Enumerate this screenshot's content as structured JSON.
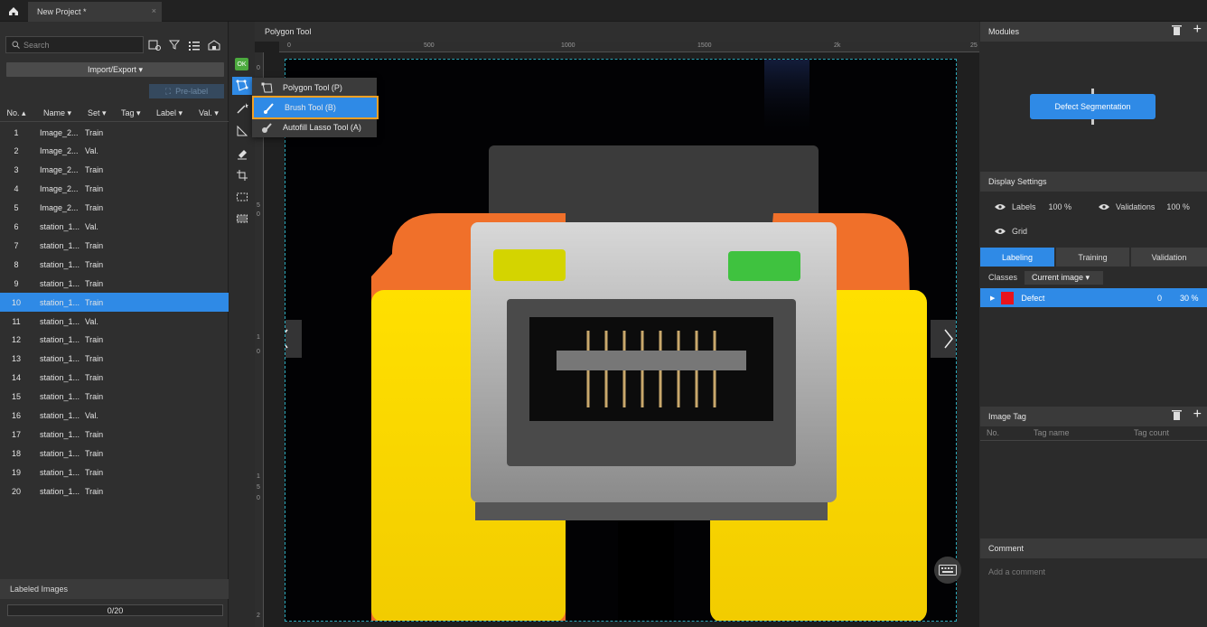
{
  "tab": {
    "title": "New Project *",
    "close": "×"
  },
  "search": {
    "placeholder": "Search"
  },
  "left": {
    "import_label": "Import/Export ▾",
    "prelabel": "Pre-label",
    "columns": [
      "No.",
      "Name",
      "Set",
      "Tag",
      "Label",
      "Val."
    ],
    "rows": [
      {
        "no": "1",
        "name": "Image_2...",
        "set": "Train"
      },
      {
        "no": "2",
        "name": "Image_2...",
        "set": "Val."
      },
      {
        "no": "3",
        "name": "Image_2...",
        "set": "Train"
      },
      {
        "no": "4",
        "name": "Image_2...",
        "set": "Train"
      },
      {
        "no": "5",
        "name": "Image_2...",
        "set": "Train"
      },
      {
        "no": "6",
        "name": "station_1...",
        "set": "Val."
      },
      {
        "no": "7",
        "name": "station_1...",
        "set": "Train"
      },
      {
        "no": "8",
        "name": "station_1...",
        "set": "Train"
      },
      {
        "no": "9",
        "name": "station_1...",
        "set": "Train"
      },
      {
        "no": "10",
        "name": "station_1...",
        "set": "Train"
      },
      {
        "no": "11",
        "name": "station_1...",
        "set": "Val."
      },
      {
        "no": "12",
        "name": "station_1...",
        "set": "Train"
      },
      {
        "no": "13",
        "name": "station_1...",
        "set": "Train"
      },
      {
        "no": "14",
        "name": "station_1...",
        "set": "Train"
      },
      {
        "no": "15",
        "name": "station_1...",
        "set": "Train"
      },
      {
        "no": "16",
        "name": "station_1...",
        "set": "Val."
      },
      {
        "no": "17",
        "name": "station_1...",
        "set": "Train"
      },
      {
        "no": "18",
        "name": "station_1...",
        "set": "Train"
      },
      {
        "no": "19",
        "name": "station_1...",
        "set": "Train"
      },
      {
        "no": "20",
        "name": "station_1...",
        "set": "Train"
      }
    ],
    "selected_row": "10",
    "labeled_header": "Labeled Images",
    "progress": "0/20",
    "progress_fraction": 0
  },
  "toolbar": {
    "ok": "OK"
  },
  "center": {
    "title": "Polygon Tool",
    "ruler_h": [
      "0",
      "500",
      "1000",
      "1500",
      "2k",
      "25"
    ],
    "ruler_v": [
      "0",
      "5",
      "0",
      "1",
      "0",
      "1",
      "5",
      "0",
      "2"
    ]
  },
  "dropdown": {
    "items": [
      {
        "label": "Polygon Tool (P)",
        "icon": "polygon-icon"
      },
      {
        "label": "Brush Tool (B)",
        "icon": "brush-icon"
      },
      {
        "label": "Autofill Lasso Tool (A)",
        "icon": "lasso-icon"
      }
    ],
    "selected": "Brush Tool (B)"
  },
  "right": {
    "modules_title": "Modules",
    "module_button": "Defect Segmentation",
    "display_title": "Display Settings",
    "labels": "Labels",
    "labels_pct": "100 %",
    "validations": "Validations",
    "validations_pct": "100 %",
    "grid": "Grid",
    "tabs": [
      "Labeling",
      "Training",
      "Validation"
    ],
    "classes_label": "Classes",
    "classes_dropdown": "Current image ▾",
    "class_row": {
      "name": "Defect",
      "count": "0",
      "pct": "30 %",
      "color": "#e8141c"
    },
    "image_tag_title": "Image Tag",
    "tag_columns": [
      "No.",
      "Tag name",
      "Tag count"
    ],
    "comment_title": "Comment",
    "comment_placeholder": "Add a comment"
  },
  "colors": {
    "accent": "#2f8ae6",
    "highlight": "#f2a023"
  }
}
